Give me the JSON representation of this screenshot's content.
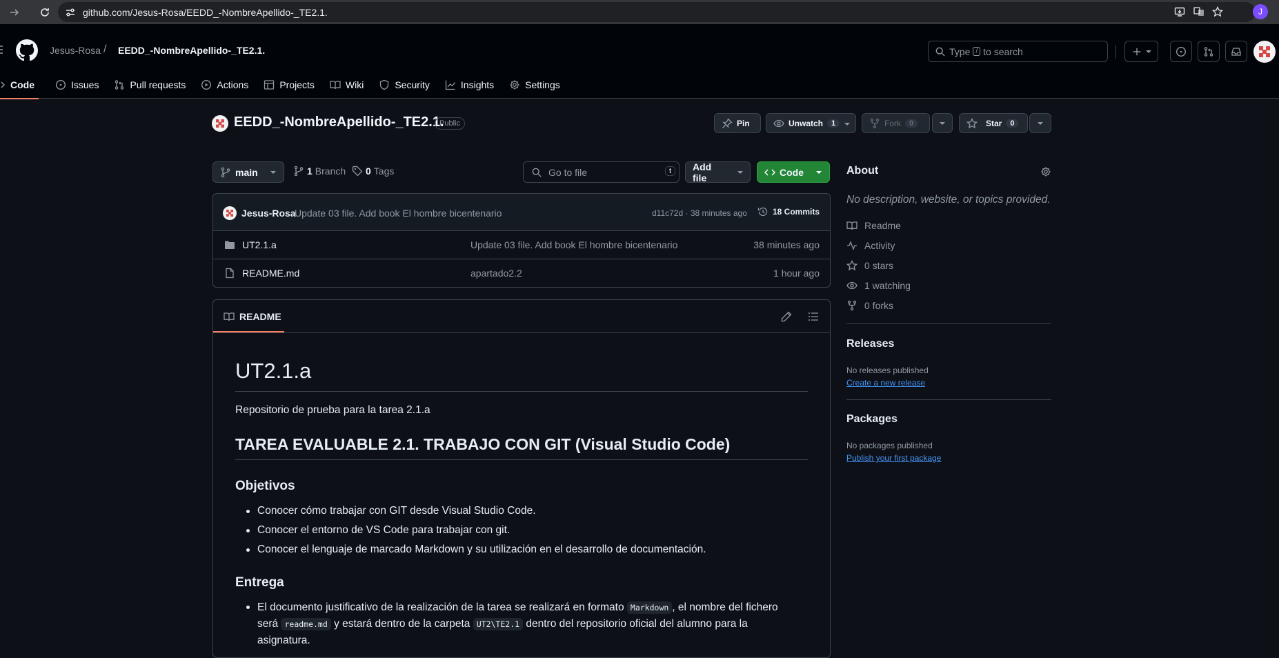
{
  "browser": {
    "url": "github.com/Jesus-Rosa/EEDD_-NombreApellido-_TE2.1.",
    "profile_initial": "J"
  },
  "header": {
    "owner": "Jesus-Rosa",
    "separator": "/",
    "repo": "EEDD_-NombreApellido-_TE2.1.",
    "search_before": "Type",
    "search_key": "/",
    "search_after": "to search"
  },
  "tabs": [
    {
      "label": "Code",
      "icon": "code-icon"
    },
    {
      "label": "Issues",
      "icon": "issue-icon"
    },
    {
      "label": "Pull requests",
      "icon": "pull-request-icon"
    },
    {
      "label": "Actions",
      "icon": "play-icon"
    },
    {
      "label": "Projects",
      "icon": "table-icon"
    },
    {
      "label": "Wiki",
      "icon": "book-icon"
    },
    {
      "label": "Security",
      "icon": "shield-icon"
    },
    {
      "label": "Insights",
      "icon": "graph-icon"
    },
    {
      "label": "Settings",
      "icon": "gear-icon"
    }
  ],
  "repo": {
    "name": "EEDD_-NombreApellido-_TE2.1.",
    "visibility": "Public",
    "pin": "Pin",
    "unwatch": "Unwatch",
    "watch_count": "1",
    "fork": "Fork",
    "fork_count": "0",
    "star": "Star",
    "star_count": "0"
  },
  "toolbar": {
    "branch": "main",
    "branch_count": "1",
    "branch_label": "Branch",
    "tag_count": "0",
    "tag_label": "Tags",
    "go_to_file": "Go to file",
    "go_to_file_key": "t",
    "add_file": "Add file",
    "code": "Code"
  },
  "commit": {
    "author": "Jesus-Rosa",
    "message": "Update 03 file. Add book El hombre bicentenario",
    "hash_time": "d11c72d · 38 minutes ago",
    "commits": "18 Commits"
  },
  "files": [
    {
      "name": "UT2.1.a",
      "type": "folder",
      "message": "Update 03 file. Add book El hombre bicentenario",
      "time": "38 minutes ago"
    },
    {
      "name": "README.md",
      "type": "file",
      "message": "apartado2.2",
      "time": "1 hour ago"
    }
  ],
  "readme": {
    "tab": "README",
    "h1": "UT2.1.a",
    "p1": "Repositorio de prueba para la tarea 2.1.a",
    "h2": "TAREA EVALUABLE 2.1. TRABAJO CON GIT (Visual Studio Code)",
    "h3a": "Objetivos",
    "objetivos": [
      "Conocer cómo trabajar con GIT desde Visual Studio Code.",
      "Conocer el entorno de VS Code para trabajar con git.",
      "Conocer el lenguaje de marcado Markdown y su utilización en el desarrollo de documentación."
    ],
    "h3b": "Entrega",
    "entrega": {
      "t1": "El documento justificativo de la realización de la tarea se realizará en formato",
      "c1": "Markdown",
      "t2": ", el nombre del fichero",
      "t3": "será",
      "c2": "readme.md",
      "t4": "y estará dentro de la carpeta",
      "c3": "UT2\\TE2.1",
      "t5": "dentro del repositorio oficial del alumno para la",
      "t6": "asignatura."
    }
  },
  "about": {
    "title": "About",
    "desc": "No description, website, or topics provided.",
    "items": [
      {
        "icon": "book-icon",
        "label": "Readme"
      },
      {
        "icon": "pulse-icon",
        "label": "Activity"
      },
      {
        "icon": "star-icon",
        "label": "0 stars"
      },
      {
        "icon": "eye-icon",
        "label": "1 watching"
      },
      {
        "icon": "fork-icon",
        "label": "0 forks"
      }
    ]
  },
  "releases": {
    "title": "Releases",
    "none": "No releases published",
    "link": "Create a new release"
  },
  "packages": {
    "title": "Packages",
    "none": "No packages published",
    "link": "Publish your first package"
  },
  "colors": {
    "accent_green": "#238636",
    "tab_underline": "#f78166",
    "link": "#4493f8",
    "background": "#0d1117"
  }
}
